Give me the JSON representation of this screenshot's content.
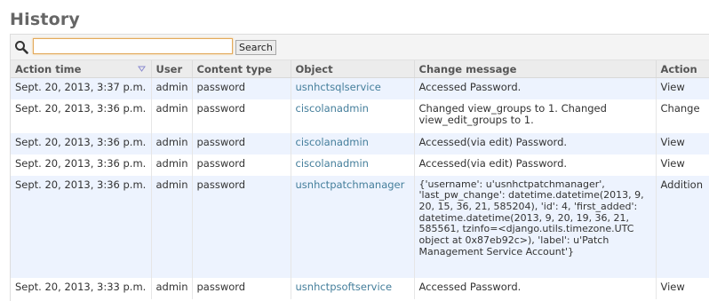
{
  "page": {
    "title": "History"
  },
  "search": {
    "placeholder": "",
    "value": "",
    "button_label": "Search"
  },
  "table": {
    "columns": [
      "Action time",
      "User",
      "Content type",
      "Object",
      "Change message",
      "Action"
    ],
    "rows": [
      {
        "time": "Sept. 20, 2013, 3:37 p.m.",
        "user": "admin",
        "ctype": "password",
        "object": "usnhctsqlservice",
        "message": "Accessed Password.",
        "action": "View"
      },
      {
        "time": "Sept. 20, 2013, 3:36 p.m.",
        "user": "admin",
        "ctype": "password",
        "object": "ciscolanadmin",
        "message": "Changed view_groups to 1. Changed view_edit_groups to 1.",
        "action": "Change"
      },
      {
        "time": "Sept. 20, 2013, 3:36 p.m.",
        "user": "admin",
        "ctype": "password",
        "object": "ciscolanadmin",
        "message": "Accessed(via edit) Password.",
        "action": "View"
      },
      {
        "time": "Sept. 20, 2013, 3:36 p.m.",
        "user": "admin",
        "ctype": "password",
        "object": "ciscolanadmin",
        "message": "Accessed(via edit) Password.",
        "action": "View"
      },
      {
        "time": "Sept. 20, 2013, 3:36 p.m.",
        "user": "admin",
        "ctype": "password",
        "object": "usnhctpatchmanager",
        "message": "{'username': u'usnhctpatchmanager', 'last_pw_change': datetime.datetime(2013, 9, 20, 15, 36, 21, 585204), 'id': 4, 'first_added': datetime.datetime(2013, 9, 20, 19, 36, 21, 585561, tzinfo=<django.utils.timezone.UTC object at 0x87eb92c>), 'label': u'Patch Management Service Account'}",
        "action": "Addition"
      },
      {
        "time": "Sept. 20, 2013, 3:33 p.m.",
        "user": "admin",
        "ctype": "password",
        "object": "usnhctpsoftservice",
        "message": "Accessed Password.",
        "action": "View"
      }
    ]
  },
  "icons": {
    "search": "magnifier-icon",
    "sort": "sort-desc-icon"
  },
  "colors": {
    "link": "#447e9b",
    "row_alt": "#edf3fe",
    "header_bg": "#ececec",
    "title": "#666666"
  }
}
